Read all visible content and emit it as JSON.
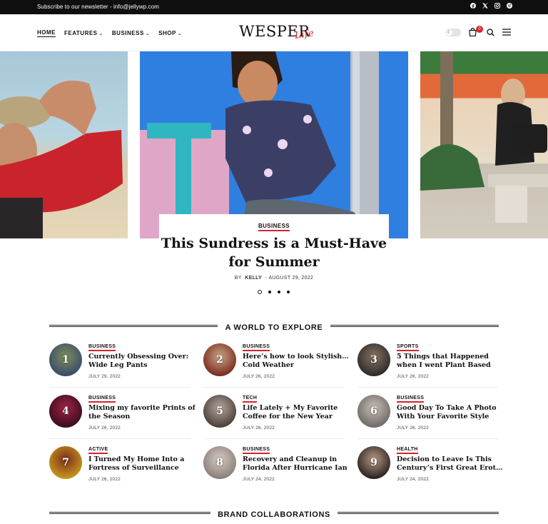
{
  "topbar": {
    "newsletter": "Subscribe to our newsletter - info@jellywp.com",
    "social": [
      "facebook-icon",
      "x-icon",
      "instagram-icon",
      "pinterest-icon"
    ]
  },
  "nav": {
    "items": [
      {
        "label": "HOME",
        "active": true
      },
      {
        "label": "FEATURES",
        "dropdown": true
      },
      {
        "label": "BUSINESS",
        "dropdown": true
      },
      {
        "label": "SHOP",
        "dropdown": true
      }
    ]
  },
  "logo": {
    "main": "WESPER",
    "script": "Life"
  },
  "header_right": {
    "cart_count": "0"
  },
  "hero": {
    "category": "BUSINESS",
    "title_line1": "This Sundress is a Must-Have",
    "title_line2": "for Summer",
    "by": "BY",
    "author": "KELLY",
    "sep": "-",
    "date": "AUGUST 29, 2022",
    "slide_count": 4,
    "active_slide": 1
  },
  "section1": {
    "title": "A WORLD TO EXPLORE"
  },
  "posts": [
    {
      "num": "1",
      "category": "BUSINESS",
      "line1": "Currently Obsessing Over:",
      "line2": "Wide Leg Pants",
      "date": "JULY 29, 2022",
      "colors": [
        "#3b4a6b",
        "#7a8f5a"
      ]
    },
    {
      "num": "2",
      "category": "BUSINESS",
      "line1": "Here’s how to look Stylish in",
      "line2": "Cold Weather",
      "date": "JULY 26, 2022",
      "colors": [
        "#7a2b1e",
        "#c9a78a"
      ]
    },
    {
      "num": "3",
      "category": "SPORTS",
      "line1": "5 Things that Happened",
      "line2": "when I went Plant Based",
      "date": "JULY 26, 2022",
      "colors": [
        "#2b2b2b",
        "#8a7260"
      ]
    },
    {
      "num": "4",
      "category": "BUSINESS",
      "line1": "Mixing my favorite Prints of",
      "line2": "the Season",
      "date": "JULY 26, 2022",
      "colors": [
        "#3a0d1e",
        "#a02444"
      ]
    },
    {
      "num": "5",
      "category": "TECH",
      "line1": "Life Lately + My Favorite",
      "line2": "Coffee for the New Year",
      "date": "JULY 26, 2022",
      "colors": [
        "#4a3f3a",
        "#b7a89c"
      ]
    },
    {
      "num": "6",
      "category": "BUSINESS",
      "line1": "Good Day To Take A Photo",
      "line2": "With Your Favorite Style",
      "date": "JULY 26, 2022",
      "colors": [
        "#6f6a66",
        "#c8beb6"
      ]
    },
    {
      "num": "7",
      "category": "ACTIVE",
      "line1": "I Turned My Home Into a",
      "line2": "Fortress of Surveillance",
      "date": "JULY 26, 2022",
      "colors": [
        "#c7961e",
        "#7a2e1c"
      ]
    },
    {
      "num": "8",
      "category": "BUSINESS",
      "line1": "Recovery and Cleanup in",
      "line2": "Florida After Hurricane Ian",
      "date": "JULY 24, 2022",
      "colors": [
        "#8a7f78",
        "#d7ccc4"
      ]
    },
    {
      "num": "9",
      "category": "HEALTH",
      "line1": "Decision to Leave Is This",
      "line2": "Century’s First Great Erotic...",
      "date": "JULY 24, 2022",
      "colors": [
        "#2a2220",
        "#b79a86"
      ]
    }
  ],
  "section2": {
    "title": "BRAND COLLABORATIONS"
  }
}
